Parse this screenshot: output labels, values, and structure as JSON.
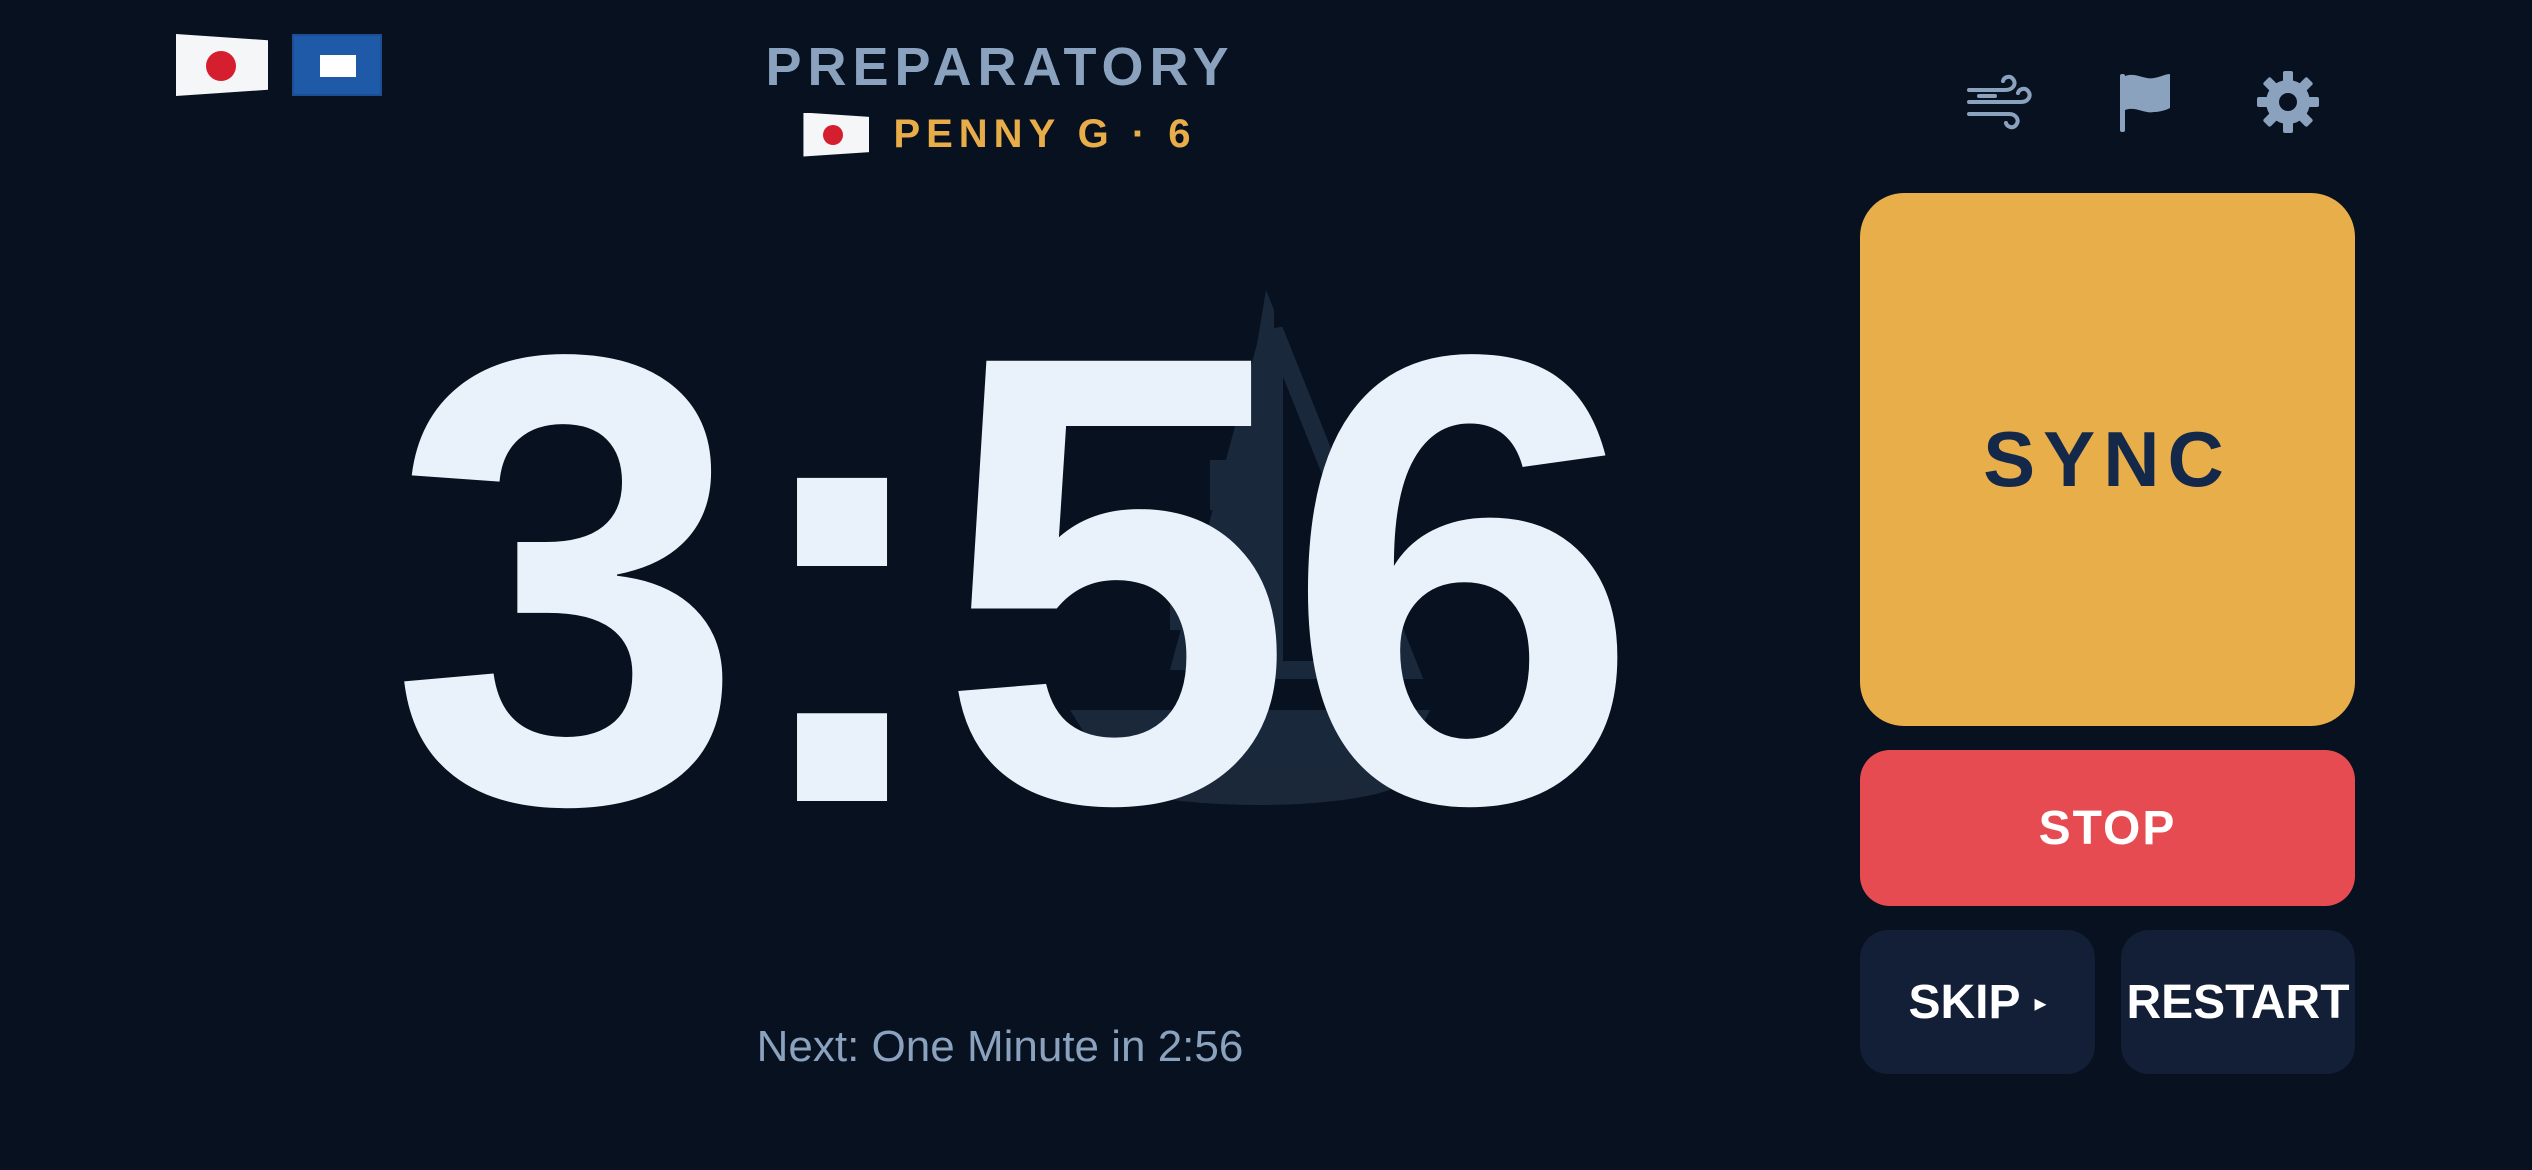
{
  "header": {
    "phase": "PREPARATORY",
    "boat": "PENNY G · 6"
  },
  "flags": {
    "left": [
      "pennant-flag-icon",
      "papa-flag-icon"
    ],
    "boat_pennant": "pennant-flag-icon"
  },
  "toolbar": {
    "icons": [
      "wind-icon",
      "flag-icon",
      "gear-icon"
    ]
  },
  "timer": {
    "value": "3:56"
  },
  "next": {
    "text": "Next: One Minute in 2:56"
  },
  "controls": {
    "sync_label": "SYNC",
    "stop_label": "STOP",
    "skip_label": "SKIP",
    "skip_arrow": "▸",
    "restart_label": "RESTART"
  },
  "colors": {
    "background": "#07111f",
    "accent": "#e8ae4a",
    "stop": "#e54b50",
    "secondary_button": "#121f36",
    "muted_text": "#8ba2bf",
    "timer_text": "#e9f2fb"
  }
}
